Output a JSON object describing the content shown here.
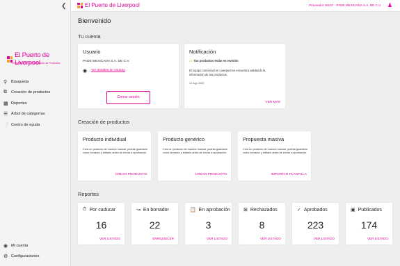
{
  "brand": {
    "name": "El Puerto de Liverpool",
    "subtitle": "Plataforma de Administración de Productos",
    "color": "#e10098"
  },
  "topbar": {
    "logo_text": "El Puerto de Liverpool",
    "provider": "Proveedor 48147 - PADE MEXICANA S.A. DE C.V."
  },
  "sidebar": {
    "collapse_icon": "chevron-left-icon",
    "items": [
      {
        "label": "Búsqueda",
        "icon": "search-icon"
      },
      {
        "label": "Creación de productos",
        "icon": "library-add-icon"
      },
      {
        "label": "Reportes",
        "icon": "report-icon"
      },
      {
        "label": "Árbol de categorías",
        "icon": "tree-icon"
      },
      {
        "label": "Centro de ayuda",
        "icon": "help-icon"
      }
    ],
    "bottom_items": [
      {
        "label": "Mi cuenta",
        "icon": "account-icon"
      },
      {
        "label": "Configuraciones",
        "icon": "gear-icon"
      }
    ]
  },
  "page": {
    "title": "Bienvenido",
    "account_section": "Tu cuenta",
    "creation_section": "Creación de productos",
    "reports_section": "Reportes"
  },
  "user_card": {
    "title": "Usuario",
    "company": "PADE MEXICANA S.A. DE C.V.",
    "details_link": "Ver detalles de usuario",
    "logout": "Cerrar sesión"
  },
  "notification_card": {
    "title": "Notificación",
    "headline": "Tus productos están en revisión",
    "body": "El equipo comercial en Liverpool se encuentra validando la información de tus productos.",
    "date": "12 Ago 2020",
    "action": "VER MÁS"
  },
  "creation_cards": [
    {
      "title": "Producto individual",
      "desc": "Crea un producto de manera manual, podrás guardarlo como borrador y editarlo antes de enviar a aprobación.",
      "action": "CREAR PRODUCTO"
    },
    {
      "title": "Producto genérico",
      "desc": "Crea un producto de manera manual, podrás guardarlo como borrador y editarlo antes de enviar a aprobación.",
      "action": "CREAR PRODUCTO"
    },
    {
      "title": "Propuesta masiva",
      "desc": "Crea un producto de manera manual, podrás guardarlo como borrador y editarlo antes de enviar a aprobación.",
      "action": "IMPORTAR PLANTILLA"
    }
  ],
  "reports": [
    {
      "title": "Por caducar",
      "icon": "stopwatch-icon",
      "value": "16",
      "action": "VER LISTADO"
    },
    {
      "title": "En borrador",
      "icon": "trending-icon",
      "value": "22",
      "action": "ENRIQUECER"
    },
    {
      "title": "En aprobación",
      "icon": "clipboard-clock-icon",
      "value": "3",
      "action": "VER LISTADO"
    },
    {
      "title": "Rechazados",
      "icon": "x-box-icon",
      "value": "8",
      "action": "VER LISTADO"
    },
    {
      "title": "Aprobados",
      "icon": "check-circle-icon",
      "value": "223",
      "action": "VER LISTADO"
    },
    {
      "title": "Publicados",
      "icon": "window-icon",
      "value": "174",
      "action": "VER LISTADO"
    }
  ]
}
